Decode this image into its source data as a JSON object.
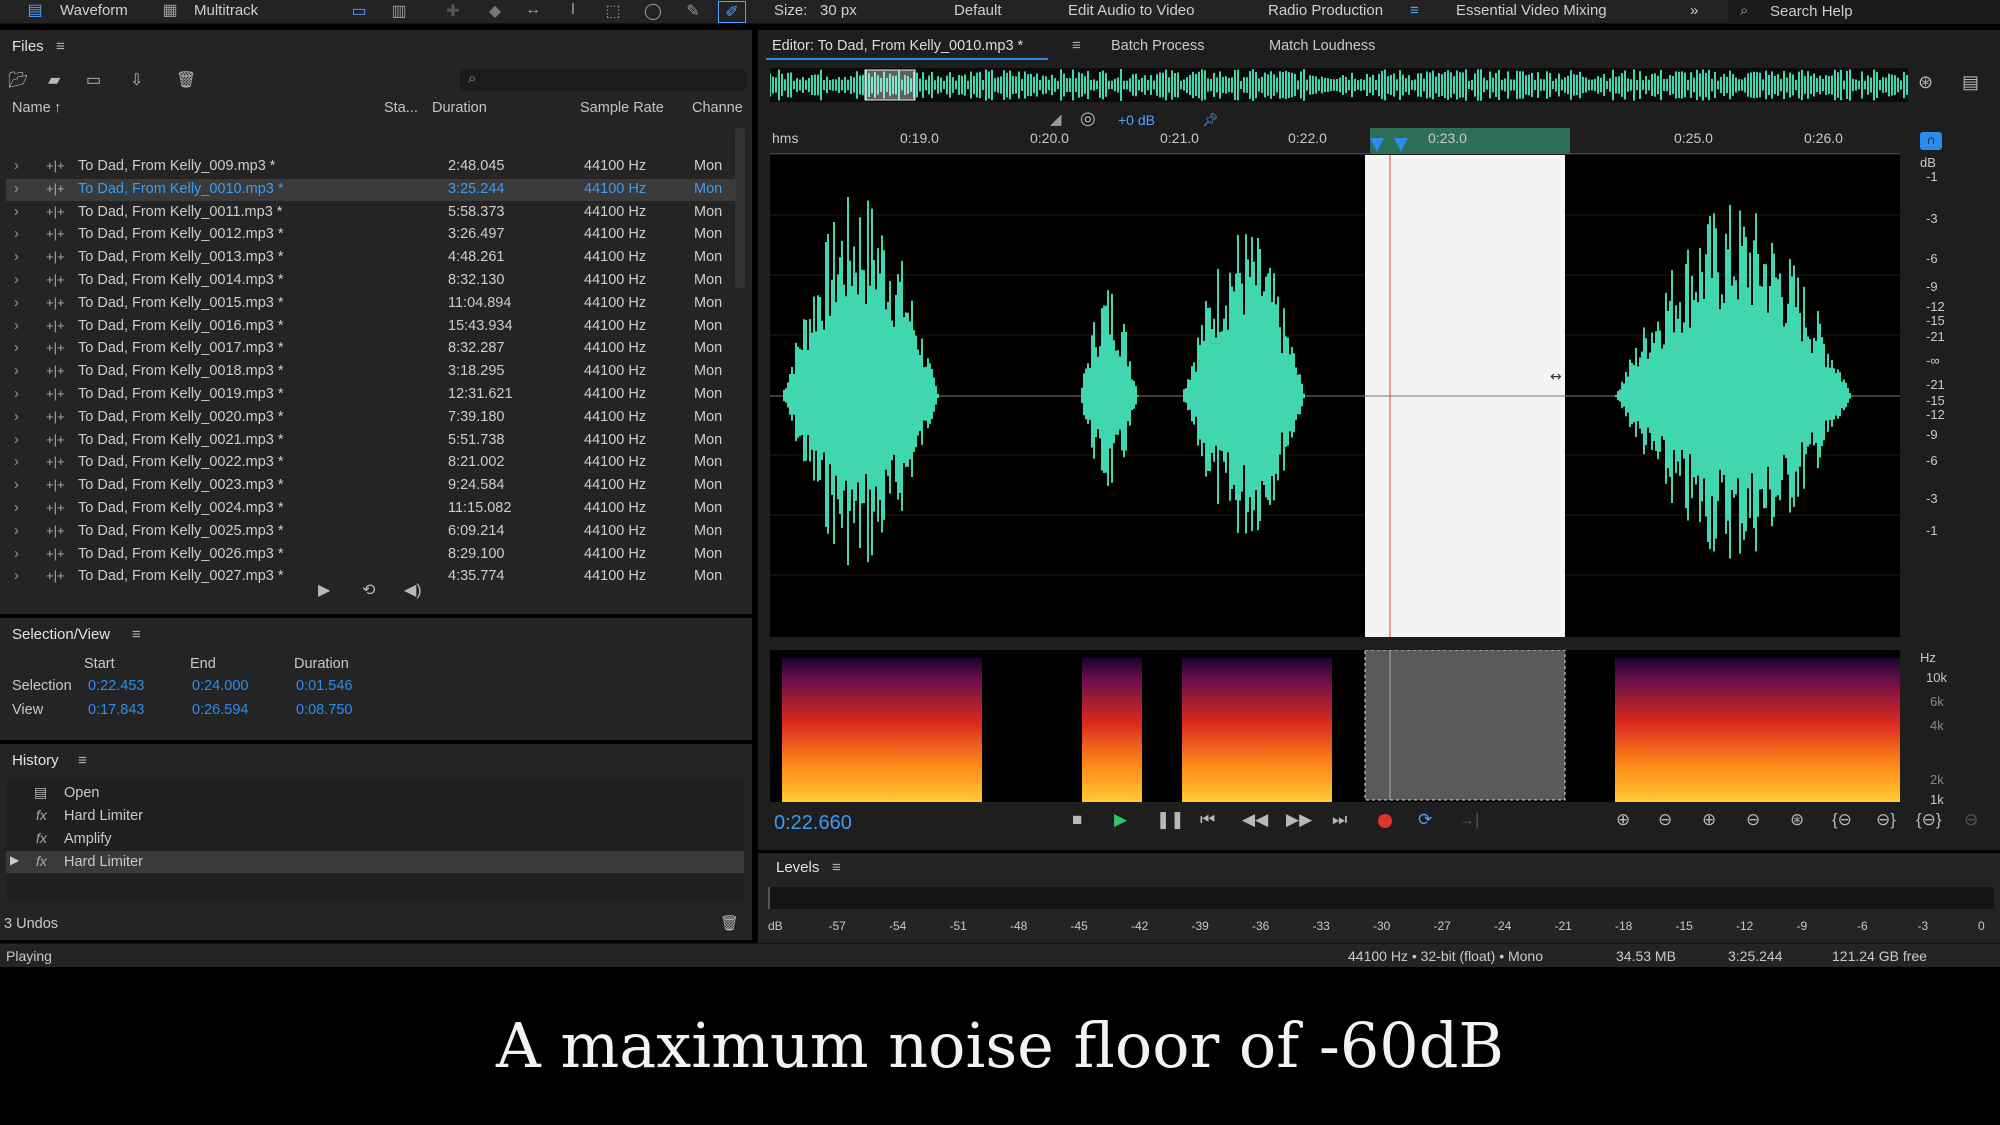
{
  "topbar": {
    "waveform": "Waveform",
    "multitrack": "Multitrack",
    "size_label": "Size:",
    "size_value": "30 px",
    "workspaces": [
      "Default",
      "Edit Audio to Video",
      "Radio Production",
      "Essential Video Mixing"
    ],
    "active_workspace": "Radio Production",
    "search_help": "Search Help"
  },
  "files": {
    "title": "Files",
    "columns": [
      "Name",
      "Sta...",
      "Duration",
      "Sample Rate",
      "Channe"
    ],
    "rows": [
      {
        "name": "To Dad, From Kelly_009.mp3 *",
        "duration": "2:48.045",
        "rate": "44100 Hz",
        "ch": "Mon"
      },
      {
        "name": "To Dad, From Kelly_0010.mp3 *",
        "duration": "3:25.244",
        "rate": "44100 Hz",
        "ch": "Mon",
        "selected": true
      },
      {
        "name": "To Dad, From Kelly_0011.mp3 *",
        "duration": "5:58.373",
        "rate": "44100 Hz",
        "ch": "Mon"
      },
      {
        "name": "To Dad, From Kelly_0012.mp3 *",
        "duration": "3:26.497",
        "rate": "44100 Hz",
        "ch": "Mon"
      },
      {
        "name": "To Dad, From Kelly_0013.mp3 *",
        "duration": "4:48.261",
        "rate": "44100 Hz",
        "ch": "Mon"
      },
      {
        "name": "To Dad, From Kelly_0014.mp3 *",
        "duration": "8:32.130",
        "rate": "44100 Hz",
        "ch": "Mon"
      },
      {
        "name": "To Dad, From Kelly_0015.mp3 *",
        "duration": "11:04.894",
        "rate": "44100 Hz",
        "ch": "Mon"
      },
      {
        "name": "To Dad, From Kelly_0016.mp3 *",
        "duration": "15:43.934",
        "rate": "44100 Hz",
        "ch": "Mon"
      },
      {
        "name": "To Dad, From Kelly_0017.mp3 *",
        "duration": "8:32.287",
        "rate": "44100 Hz",
        "ch": "Mon"
      },
      {
        "name": "To Dad, From Kelly_0018.mp3 *",
        "duration": "3:18.295",
        "rate": "44100 Hz",
        "ch": "Mon"
      },
      {
        "name": "To Dad, From Kelly_0019.mp3 *",
        "duration": "12:31.621",
        "rate": "44100 Hz",
        "ch": "Mon"
      },
      {
        "name": "To Dad, From Kelly_0020.mp3 *",
        "duration": "7:39.180",
        "rate": "44100 Hz",
        "ch": "Mon"
      },
      {
        "name": "To Dad, From Kelly_0021.mp3 *",
        "duration": "5:51.738",
        "rate": "44100 Hz",
        "ch": "Mon"
      },
      {
        "name": "To Dad, From Kelly_0022.mp3 *",
        "duration": "8:21.002",
        "rate": "44100 Hz",
        "ch": "Mon"
      },
      {
        "name": "To Dad, From Kelly_0023.mp3 *",
        "duration": "9:24.584",
        "rate": "44100 Hz",
        "ch": "Mon"
      },
      {
        "name": "To Dad, From Kelly_0024.mp3 *",
        "duration": "11:15.082",
        "rate": "44100 Hz",
        "ch": "Mon"
      },
      {
        "name": "To Dad, From Kelly_0025.mp3 *",
        "duration": "6:09.214",
        "rate": "44100 Hz",
        "ch": "Mon"
      },
      {
        "name": "To Dad, From Kelly_0026.mp3 *",
        "duration": "8:29.100",
        "rate": "44100 Hz",
        "ch": "Mon"
      },
      {
        "name": "To Dad, From Kelly_0027.mp3 *",
        "duration": "4:35.774",
        "rate": "44100 Hz",
        "ch": "Mon"
      }
    ]
  },
  "selection_view": {
    "title": "Selection/View",
    "headers": [
      "Start",
      "End",
      "Duration"
    ],
    "selection_label": "Selection",
    "selection": [
      "0:22.453",
      "0:24.000",
      "0:01.546"
    ],
    "view_label": "View",
    "view": [
      "0:17.843",
      "0:26.594",
      "0:08.750"
    ]
  },
  "history": {
    "title": "History",
    "items": [
      "Open",
      "Hard Limiter",
      "Amplify",
      "Hard Limiter"
    ],
    "undos": "3 Undos"
  },
  "status": {
    "playing": "Playing",
    "format": "44100 Hz • 32-bit (float) • Mono",
    "size": "34.53 MB",
    "duration": "3:25.244",
    "free": "121.24 GB free"
  },
  "editor": {
    "tab_title": "Editor: To Dad, From Kelly_0010.mp3 *",
    "batch_process": "Batch Process",
    "match_loudness": "Match Loudness",
    "gain": "+0 dB",
    "time_unit": "hms",
    "time_ticks": [
      "0:19.0",
      "0:20.0",
      "0:21.0",
      "0:22.0",
      "0:23.0",
      "0:25.0",
      "0:26.0"
    ],
    "db_unit": "dB",
    "db_ticks": [
      "-1",
      "-3",
      "-6",
      "-9",
      "-12",
      "-15",
      "-21",
      "-∞",
      "-21",
      "-15",
      "-12",
      "-9",
      "-6",
      "-3",
      "-1"
    ],
    "hz_unit": "Hz",
    "hz_ticks": [
      "10k",
      "6k",
      "4k",
      "2k",
      "1k"
    ],
    "current_time": "0:22.660"
  },
  "levels": {
    "title": "Levels",
    "scale": [
      "dB",
      "-57",
      "-54",
      "-51",
      "-48",
      "-45",
      "-42",
      "-39",
      "-36",
      "-33",
      "-30",
      "-27",
      "-24",
      "-21",
      "-18",
      "-15",
      "-12",
      "-9",
      "-6",
      "-3",
      "0"
    ]
  },
  "caption": "A maximum noise floor of -60dB",
  "colors": {
    "accent": "#2d8ceb",
    "waveform": "#3fd6b0",
    "selection": "#f4f4f4"
  }
}
